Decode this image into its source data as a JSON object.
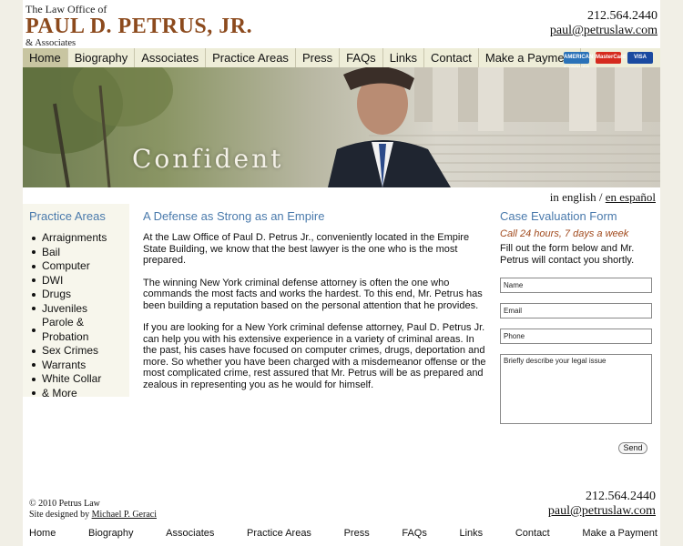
{
  "header": {
    "pre": "The Law Office of",
    "name": "PAUL D. PETRUS, JR.",
    "post": "& Associates",
    "phone": "212.564.2440",
    "email": "paul@petruslaw.com"
  },
  "nav": {
    "items": [
      "Home",
      "Biography",
      "Associates",
      "Practice Areas",
      "Press",
      "FAQs",
      "Links",
      "Contact",
      "Make a Payment"
    ],
    "active": "Home",
    "cards": [
      "AMERICAN EXPRESS",
      "MasterCard",
      "VISA"
    ]
  },
  "hero": {
    "word": "Confident"
  },
  "language": {
    "english": "in english",
    "separator": "/",
    "spanish": "en español"
  },
  "sidebar": {
    "title": "Practice Areas",
    "items": [
      "Arraignments",
      "Bail",
      "Computer",
      "DWI",
      "Drugs",
      "Juveniles",
      "Parole & Probation",
      "Sex Crimes",
      "Warrants",
      "White Collar",
      "& More"
    ]
  },
  "main": {
    "title": "A Defense as Strong as an Empire",
    "paragraphs": [
      "At the Law Office of Paul D. Petrus Jr., conveniently located in the Empire State Building, we know that the best lawyer is the one who is the most prepared.",
      "The winning New York criminal defense attorney is often the one who commands the most facts and works the hardest. To this end, Mr. Petrus has been building a reputation based on the personal attention that he provides.",
      "If you are looking for a New York criminal defense attorney, Paul D. Petrus Jr. can help you with his extensive experience in a variety of criminal areas. In the past, his cases have focused on computer crimes, drugs, deportation and more. So whether you have been charged with a misdemeanor offense or the most complicated crime, rest assured that Mr. Petrus will be as prepared and zealous in representing you as he would for himself."
    ]
  },
  "form": {
    "title": "Case Evaluation Form",
    "hours": "Call 24 hours, 7 days a week",
    "instructions": "Fill out the form below and Mr. Petrus will contact you shortly.",
    "name_placeholder": "Name",
    "email_placeholder": "Email",
    "phone_placeholder": "Phone",
    "issue_placeholder": "Briefly describe your legal issue",
    "send_label": "Send"
  },
  "footer": {
    "copyright": "© 2010 Petrus Law",
    "designed_prefix": "Site designed by",
    "designer": "Michael P. Geraci",
    "phone": "212.564.2440",
    "email": "paul@petruslaw.com",
    "nav": [
      "Home",
      "Biography",
      "Associates",
      "Practice Areas",
      "Press",
      "FAQs",
      "Links",
      "Contact",
      "Make a Payment"
    ]
  },
  "colors": {
    "brand": "#8c4a1d",
    "accent_blue": "#4a7aac",
    "nav_bg": "#eeedd8",
    "nav_active": "#c8c5a1",
    "hours_red": "#a14a1d"
  }
}
